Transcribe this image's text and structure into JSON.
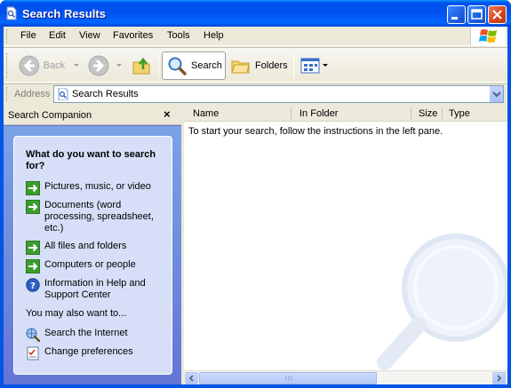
{
  "window": {
    "title": "Search Results"
  },
  "menubar": {
    "items": [
      "File",
      "Edit",
      "View",
      "Favorites",
      "Tools",
      "Help"
    ]
  },
  "toolbar": {
    "back_label": "Back",
    "search_label": "Search",
    "folders_label": "Folders"
  },
  "address": {
    "label": "Address",
    "value": "Search Results"
  },
  "left_pane": {
    "title": "Search Companion",
    "close_glyph": "×",
    "question": "What do you want to search for?",
    "options": [
      "Pictures, music, or video",
      "Documents (word processing, spreadsheet, etc.)",
      "All files and folders",
      "Computers or people",
      "Information in Help and Support Center"
    ],
    "also_heading": "You may also want to...",
    "also_options": [
      "Search the Internet",
      "Change preferences"
    ]
  },
  "results": {
    "columns": [
      "Name",
      "In Folder",
      "Size",
      "Type"
    ],
    "message": "To start your search, follow the instructions in the left pane."
  },
  "colors": {
    "title_bar": "#0055e5",
    "panel_bg": "#d6dff7",
    "pane_gradient_top": "#7ba2e7",
    "pane_gradient_bottom": "#6375d6"
  }
}
